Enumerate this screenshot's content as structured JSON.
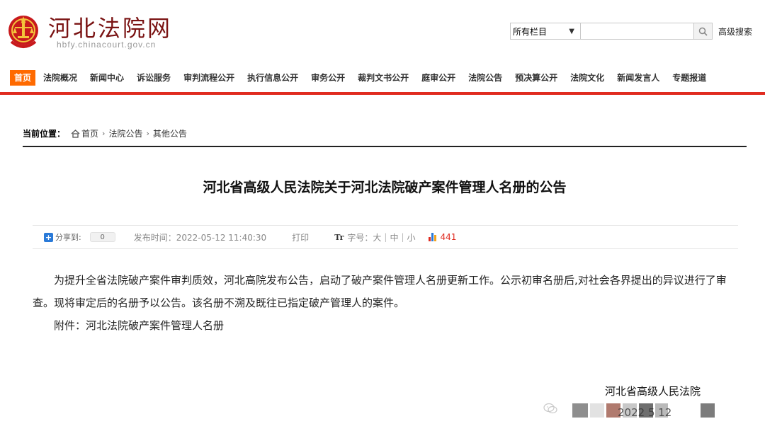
{
  "header": {
    "site_title": "河北法院网",
    "site_url": "hbfy.chinacourt.gov.cn",
    "search": {
      "category": "所有栏目",
      "placeholder": "",
      "advanced_label": "高级搜索"
    }
  },
  "nav": {
    "items": [
      {
        "label": "首页",
        "active": true
      },
      {
        "label": "法院概况"
      },
      {
        "label": "新闻中心"
      },
      {
        "label": "诉讼服务"
      },
      {
        "label": "审判流程公开"
      },
      {
        "label": "执行信息公开"
      },
      {
        "label": "审务公开"
      },
      {
        "label": "裁判文书公开"
      },
      {
        "label": "庭审公开"
      },
      {
        "label": "法院公告"
      },
      {
        "label": "预决算公开"
      },
      {
        "label": "法院文化"
      },
      {
        "label": "新闻发言人"
      },
      {
        "label": "专题报道"
      }
    ]
  },
  "breadcrumb": {
    "label": "当前位置：",
    "items": [
      "首页",
      "法院公告",
      "其他公告"
    ]
  },
  "article": {
    "title": "河北省高级人民法院关于河北法院破产案件管理人名册的公告",
    "meta": {
      "share_label": "分享到:",
      "share_count": "0",
      "publish_time": "发布时间：2022-05-12 11:40:30",
      "print_label": "打印",
      "tt_icon": "Tr",
      "fontsize_label": "字号：",
      "fontsize_large": "大",
      "fontsize_medium": "中",
      "fontsize_small": "小",
      "views": "441"
    },
    "paragraphs": [
      "为提升全省法院破产案件审判质效，河北高院发布公告，启动了破产案件管理人名册更新工作。公示初审名册后,对社会各界提出的异议进行了审查。现将审定后的名册予以公告。该名册不溯及既往已指定破产管理人的案件。",
      "附件：河北法院破产案件管理人名册"
    ],
    "signature": "河北省高级人民法院",
    "date_fragment": "2022 5 12"
  },
  "colors": {
    "accent": "#e02b20",
    "nav_active": "#ff6a00",
    "title_red": "#7a1313"
  }
}
